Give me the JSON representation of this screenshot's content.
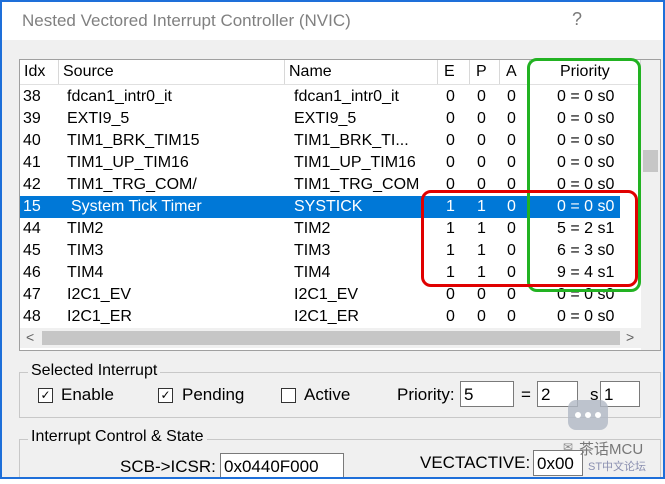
{
  "window": {
    "title": "Nested Vectored Interrupt Controller (NVIC)",
    "help": "?"
  },
  "table": {
    "columns": [
      "Idx",
      "Source",
      "Name",
      "E",
      "P",
      "A",
      "Priority"
    ],
    "rows": [
      {
        "idx": "38",
        "source": "fdcan1_intr0_it",
        "name": "fdcan1_intr0_it",
        "e": "0",
        "p": "0",
        "a": "0",
        "priority": "0 = 0 s0",
        "selected": false
      },
      {
        "idx": "39",
        "source": "EXTI9_5",
        "name": "EXTI9_5",
        "e": "0",
        "p": "0",
        "a": "0",
        "priority": "0 = 0 s0",
        "selected": false
      },
      {
        "idx": "40",
        "source": "TIM1_BRK_TIM15",
        "name": "TIM1_BRK_TI...",
        "e": "0",
        "p": "0",
        "a": "0",
        "priority": "0 = 0 s0",
        "selected": false
      },
      {
        "idx": "41",
        "source": "TIM1_UP_TIM16",
        "name": "TIM1_UP_TIM16",
        "e": "0",
        "p": "0",
        "a": "0",
        "priority": "0 = 0 s0",
        "selected": false
      },
      {
        "idx": "42",
        "source": "TIM1_TRG_COM/",
        "name": "TIM1_TRG_COM",
        "e": "0",
        "p": "0",
        "a": "0",
        "priority": "0 = 0 s0",
        "selected": false
      },
      {
        "idx": "15",
        "source": "System Tick Timer",
        "name": "SYSTICK",
        "e": "1",
        "p": "1",
        "a": "0",
        "priority": "0 = 0 s0",
        "selected": true
      },
      {
        "idx": "44",
        "source": "TIM2",
        "name": "TIM2",
        "e": "1",
        "p": "1",
        "a": "0",
        "priority": "5 = 2 s1",
        "selected": false
      },
      {
        "idx": "45",
        "source": "TIM3",
        "name": "TIM3",
        "e": "1",
        "p": "1",
        "a": "0",
        "priority": "6 = 3 s0",
        "selected": false
      },
      {
        "idx": "46",
        "source": "TIM4",
        "name": "TIM4",
        "e": "1",
        "p": "1",
        "a": "0",
        "priority": "9 = 4 s1",
        "selected": false
      },
      {
        "idx": "47",
        "source": "I2C1_EV",
        "name": "I2C1_EV",
        "e": "0",
        "p": "0",
        "a": "0",
        "priority": "0 = 0 s0",
        "selected": false
      },
      {
        "idx": "48",
        "source": "I2C1_ER",
        "name": "I2C1_ER",
        "e": "0",
        "p": "0",
        "a": "0",
        "priority": "0 = 0 s0",
        "selected": false
      }
    ]
  },
  "selected_interrupt": {
    "group_label": "Selected Interrupt",
    "enable_label": "Enable",
    "enable_checked": true,
    "pending_label": "Pending",
    "pending_checked": true,
    "active_label": "Active",
    "active_checked": false,
    "priority_label": "Priority:",
    "priority_value": "5",
    "equals": "=",
    "group_value": "2",
    "sub_label": "s",
    "sub_value": "1"
  },
  "control_state": {
    "group_label": "Interrupt Control & State",
    "icsr_label": "SCB->ICSR:",
    "icsr_value": "0x0440F000",
    "vectactive_label": "VECTACTIVE:",
    "vectactive_value": "0x00"
  },
  "watermark": {
    "name": "茶话MCU",
    "sub": "ST中文论坛"
  },
  "colors": {
    "selection": "#0078d7",
    "title_border": "#1e6fd9",
    "red_annotation": "#e00000",
    "green_annotation": "#22b222"
  }
}
